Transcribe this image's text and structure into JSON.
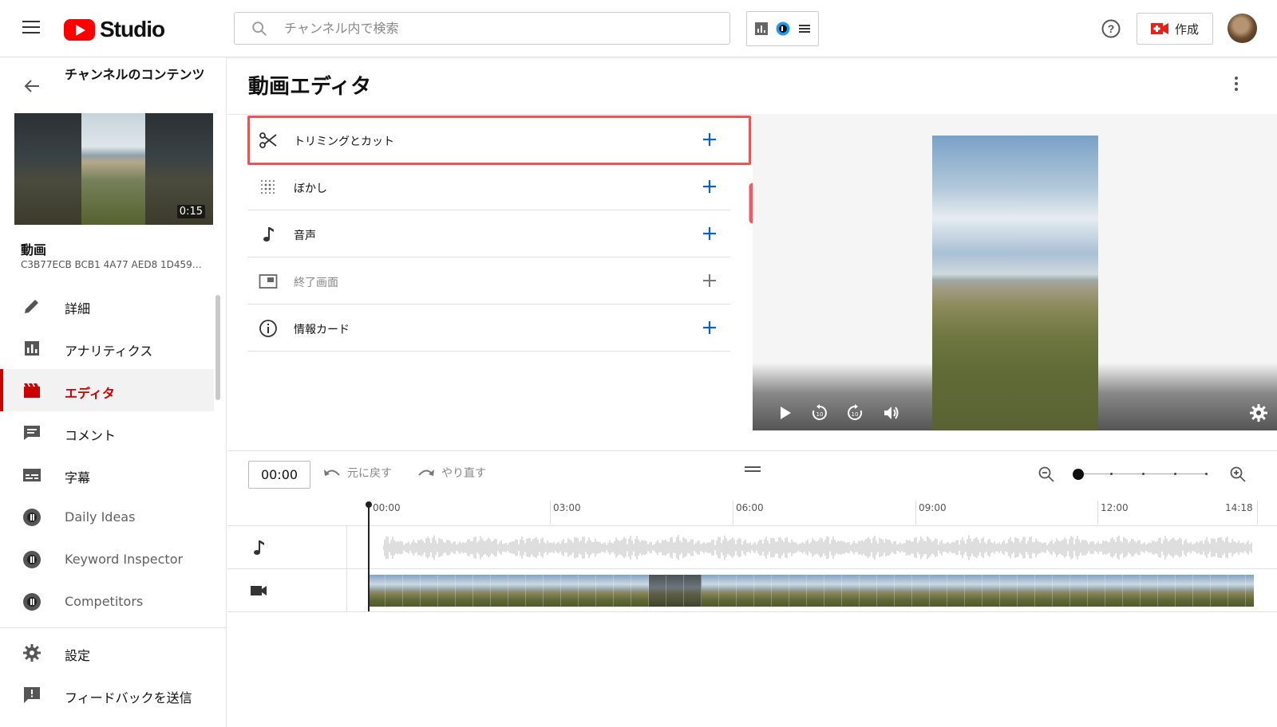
{
  "app": {
    "logo_text": "Studio",
    "brand_color": "#ff0000",
    "accent_color": "#065fd4"
  },
  "search": {
    "placeholder": "チャンネル内で検索",
    "value": ""
  },
  "header": {
    "create_label": "作成"
  },
  "sidebar": {
    "back_title": "チャンネルのコンテンツ",
    "thumbnail_duration": "0:15",
    "video_label": "動画",
    "video_id": "C3B77ECB BCB1 4A77 AED8 1D459…",
    "items": [
      {
        "label": "詳細",
        "icon": "pencil-icon",
        "active": false
      },
      {
        "label": "アナリティクス",
        "icon": "analytics-icon",
        "active": false
      },
      {
        "label": "エディタ",
        "icon": "editor-clapper-icon",
        "active": true
      },
      {
        "label": "コメント",
        "icon": "comment-icon",
        "active": false
      },
      {
        "label": "字幕",
        "icon": "subtitles-icon",
        "active": false
      },
      {
        "label": "Daily Ideas",
        "icon": "vidiq-icon",
        "active": false
      },
      {
        "label": "Keyword Inspector",
        "icon": "vidiq-icon",
        "active": false
      },
      {
        "label": "Competitors",
        "icon": "vidiq-icon",
        "active": false
      }
    ],
    "bottom_items": [
      {
        "label": "設定",
        "icon": "gear-icon"
      },
      {
        "label": "フィードバックを送信",
        "icon": "feedback-icon"
      }
    ]
  },
  "main": {
    "title": "動画エディタ",
    "tools": [
      {
        "label": "トリミングとカット",
        "icon": "scissors-icon",
        "enabled": true,
        "highlighted": true
      },
      {
        "label": "ぼかし",
        "icon": "blur-icon",
        "enabled": true,
        "highlighted": false
      },
      {
        "label": "音声",
        "icon": "music-note-icon",
        "enabled": true,
        "highlighted": false
      },
      {
        "label": "終了画面",
        "icon": "end-screen-icon",
        "enabled": false,
        "highlighted": false
      },
      {
        "label": "情報カード",
        "icon": "info-icon",
        "enabled": true,
        "highlighted": false
      }
    ],
    "highlight_color": "#e85658"
  },
  "timeline": {
    "current_time": "00:00",
    "undo_label": "元に戻す",
    "redo_label": "やり直す",
    "ticks": [
      "00:00",
      "03:00",
      "06:00",
      "09:00",
      "12:00",
      "14:18"
    ]
  }
}
